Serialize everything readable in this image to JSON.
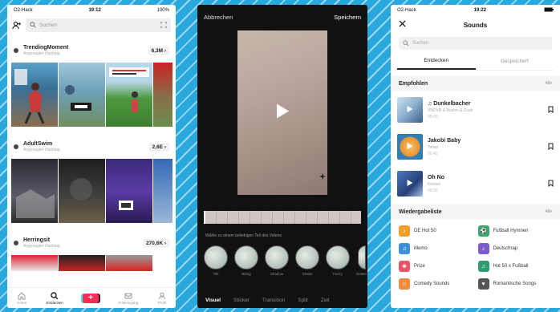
{
  "colors": {
    "background": "#29a8de",
    "accent": "#fe2c55",
    "cyan": "#25f4ee"
  },
  "discover": {
    "status": {
      "carrier": "O2-Hack",
      "time": "19:12",
      "battery": "100%"
    },
    "search_placeholder": "Suchen",
    "hashtags": [
      {
        "name": "TrendingMoment",
        "subtitle": "Angesagter Hashtag",
        "count": "6,3M ›"
      },
      {
        "name": "AdultSwim",
        "subtitle": "Angesagter Hashtag",
        "count": "2,6E ›"
      },
      {
        "name": "Herringsit",
        "subtitle": "Angesagter Hashtag",
        "count": "270,6K ›"
      }
    ],
    "tabs": [
      {
        "label": "Home",
        "icon": "home-icon"
      },
      {
        "label": "Entdecken",
        "icon": "search-icon"
      },
      {
        "label": "",
        "icon": "plus-icon"
      },
      {
        "label": "Posteingang",
        "icon": "inbox-icon"
      },
      {
        "label": "Profil",
        "icon": "profile-icon"
      }
    ]
  },
  "editor": {
    "cancel_label": "Abbrechen",
    "save_label": "Speichern",
    "hint": "Wähle zu einem beliebigen Teil des Videos",
    "filters": [
      "Tile",
      "Biting",
      "Shadow",
      "Shake",
      "Fuzzy",
      "Delete"
    ],
    "tabs": [
      "Visuel",
      "Sticker",
      "Transition",
      "Split",
      "Zeit"
    ],
    "active_tab_index": 0
  },
  "sounds": {
    "status": {
      "carrier": "O2-Hack",
      "time": "19:22"
    },
    "title": "Sounds",
    "search_placeholder": "Suchen",
    "tabs": [
      "Entdecken",
      "Gespeichert"
    ],
    "recommended_title": "Empfohlen",
    "more_label": "Alle",
    "songs": [
      {
        "title": "♫ Dunkelbacher",
        "artist": "VNDVR & Bushin & Zuuk",
        "duration": "00:60"
      },
      {
        "title": "Jakobi Baby",
        "artist": "Tetian",
        "duration": "00:45"
      },
      {
        "title": "Oh No",
        "artist": "Kreosd",
        "duration": "00:60"
      }
    ],
    "playlists_title": "Wiedergabeliste",
    "playlists": [
      {
        "label": "DE Hot 50",
        "color": "#f2a02b",
        "glyph": "♪"
      },
      {
        "label": "Fußball Hymnen",
        "color": "#3aa86b",
        "glyph": "⚽"
      },
      {
        "label": "Memo",
        "color": "#3c8fd6",
        "glyph": "♫"
      },
      {
        "label": "Deutschrap",
        "color": "#7c5cc9",
        "glyph": "♪"
      },
      {
        "label": "Prize",
        "color": "#e9546b",
        "glyph": "★"
      },
      {
        "label": "Hot 50 x Fußball",
        "color": "#2f9d6f",
        "glyph": "♫"
      },
      {
        "label": "Comedy Sounds",
        "color": "#f08a3c",
        "glyph": "☺"
      },
      {
        "label": "Romantische Songs",
        "color": "#555555",
        "glyph": "♥"
      }
    ]
  }
}
